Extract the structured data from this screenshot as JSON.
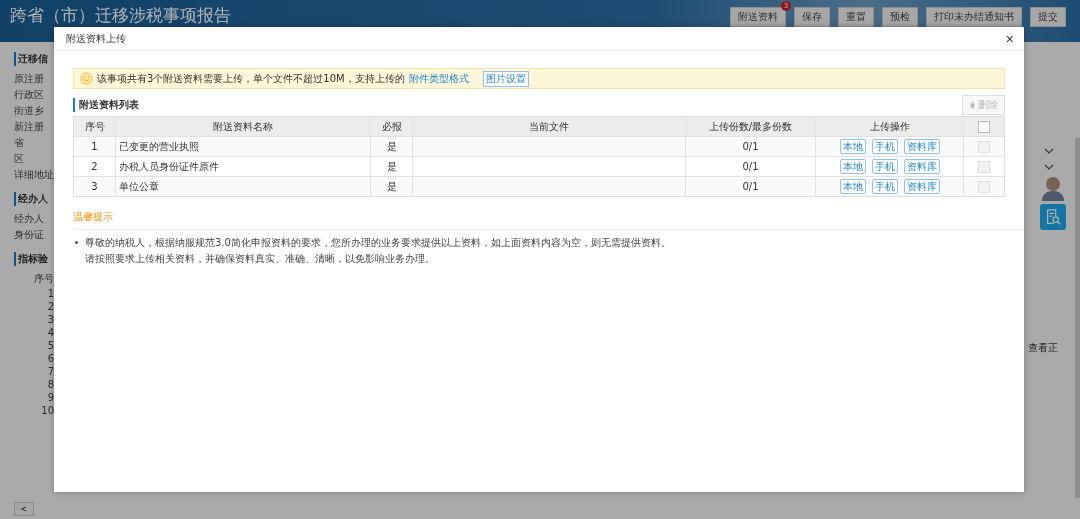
{
  "page": {
    "title": "跨省（市）迁移涉税事项报告",
    "toolbar": [
      {
        "label": "附送资料",
        "badge": "3"
      },
      {
        "label": "保存"
      },
      {
        "label": "重置"
      },
      {
        "label": "预检"
      },
      {
        "label": "打印未办结通知书"
      },
      {
        "label": "提交"
      }
    ],
    "sections": [
      {
        "title": "迁移信",
        "fields": [
          "原注册",
          "行政区",
          "街道乡",
          "新注册",
          "省",
          "区",
          "详细地址"
        ]
      },
      {
        "title": "经办人",
        "fields": [
          "经办人",
          "身份证"
        ]
      },
      {
        "title": "指标验",
        "fields": [
          "序号",
          "1",
          "2",
          "3",
          "4",
          "5",
          "6",
          "7",
          "8",
          "9",
          "10"
        ]
      }
    ],
    "pager_prev": "<",
    "side_link": "查看正"
  },
  "dialog": {
    "title": "附送资料上传",
    "close": "×",
    "notice": {
      "text": "该事项共有3个附送资料需要上传，单个文件不超过10M，支持上传的",
      "link": "附件类型格式",
      "button": "图片设置"
    },
    "list_title": "附送资料列表",
    "delete_button": {
      "label": "删除",
      "disabled": true
    },
    "table": {
      "columns": [
        "序号",
        "附送资料名称",
        "必报",
        "当前文件",
        "上传份数/最多份数",
        "上传操作"
      ],
      "header_checkbox": {
        "checked": false,
        "disabled": false
      },
      "rows": [
        {
          "no": "1",
          "name": "已变更的营业执照",
          "required": "是",
          "file": "",
          "count": "0/1",
          "actions": [
            "本地",
            "手机",
            "资料库"
          ],
          "checked": false,
          "disabled": true
        },
        {
          "no": "2",
          "name": "办税人员身份证件原件",
          "required": "是",
          "file": "",
          "count": "0/1",
          "actions": [
            "本地",
            "手机",
            "资料库"
          ],
          "checked": false,
          "disabled": true
        },
        {
          "no": "3",
          "name": "单位公章",
          "required": "是",
          "file": "",
          "count": "0/1",
          "actions": [
            "本地",
            "手机",
            "资料库"
          ],
          "checked": false,
          "disabled": true
        }
      ]
    },
    "tips_title": "温馨提示",
    "tips": [
      {
        "lines": [
          "尊敬的纳税人，根据纳服规范3.0简化申报资料的要求，您所办理的业务要求提供以上资料，如上面资料内容为空，则无需提供资料。",
          "请按照要求上传相关资料，并确保资料真实、准确、清晰，以免影响业务办理。"
        ]
      }
    ]
  }
}
